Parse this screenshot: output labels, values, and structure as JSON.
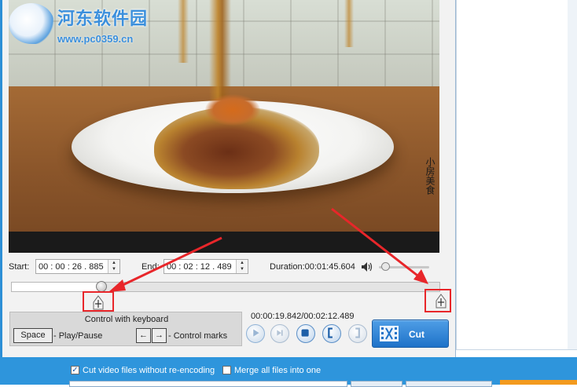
{
  "video": {
    "watermark_title": "河东软件园",
    "watermark_url": "www.pc0359.cn",
    "caption_vertical": "小房美食"
  },
  "times": {
    "start_label": "Start:",
    "start_value": "00 : 00 : 26 . 885",
    "end_label": "End:",
    "end_value": "00 : 02 : 12 . 489",
    "duration_text": "Duration:00:01:45.604"
  },
  "timeline": {
    "played_fraction": 0.21,
    "volume_fraction": 0.05
  },
  "keyboard": {
    "title": "Control with keyboard",
    "space_key": "Space",
    "space_desc": "- Play/Pause",
    "left_key": "←",
    "right_key": "→",
    "arrows_desc": "- Control marks"
  },
  "player": {
    "position_text": "00:00:19.842/00:02:12.489",
    "cut_label": "Cut"
  },
  "options": {
    "no_reencode_label": "Cut video files without re-encoding",
    "no_reencode_checked": true,
    "merge_label": "Merge all files into one",
    "merge_checked": false
  },
  "icons": {
    "speaker": "speaker-icon",
    "marker": "cut-marker-icon",
    "play": "play-icon",
    "next": "next-frame-icon",
    "stop": "stop-icon",
    "mark_in": "mark-in-icon",
    "mark_out": "mark-out-icon",
    "cut": "scissors-film-icon"
  },
  "colors": {
    "accent": "#2e95dc",
    "highlight": "#e8262a"
  }
}
